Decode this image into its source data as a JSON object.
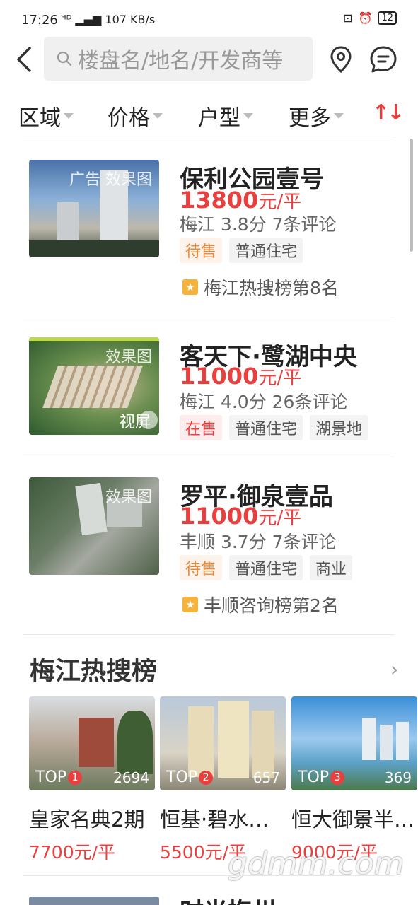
{
  "status_bar": {
    "time": "17:26",
    "network": "107 KB/s",
    "battery": "12"
  },
  "search": {
    "placeholder": "楼盘名/地名/开发商等"
  },
  "filters": {
    "region": "区域",
    "price": "价格",
    "layout": "户型",
    "more": "更多"
  },
  "listings": [
    {
      "name": "保利公园壹号",
      "price": "13800",
      "unit": "元/平",
      "meta": "梅江  3.8分  7条评论",
      "image_tag": "广告  效果图",
      "tags": [
        "待售",
        "普通住宅"
      ],
      "rank": "梅江热搜榜第8名"
    },
    {
      "name": "客天下·鹭湖中央",
      "price": "11000",
      "unit": "元/平",
      "meta": "梅江  4.0分  26条评论",
      "image_tag": "效果图",
      "image_extra": "视屏",
      "tags": [
        "在售",
        "普通住宅",
        "湖景地"
      ]
    },
    {
      "name": "罗平·御泉壹品",
      "price": "11000",
      "unit": "元/平",
      "meta": "丰顺  3.7分  7条评论",
      "image_tag": "效果图",
      "tags": [
        "待售",
        "普通住宅",
        "商业"
      ],
      "rank": "丰顺咨询榜第2名"
    }
  ],
  "hot": {
    "title": "梅江热搜榜",
    "cards": [
      {
        "top": "TOP",
        "rank": "1",
        "count": "2694",
        "name": "皇家名典2期",
        "price": "7700元/平"
      },
      {
        "top": "TOP",
        "rank": "2",
        "count": "657",
        "name": "恒基·碧水…",
        "price": "5500元/平"
      },
      {
        "top": "TOP",
        "rank": "3",
        "count": "369",
        "name": "恒大御景半…",
        "price": "9000元/平"
      }
    ]
  },
  "next_listing_title": "时光梅州",
  "watermark": "gdmm.com"
}
